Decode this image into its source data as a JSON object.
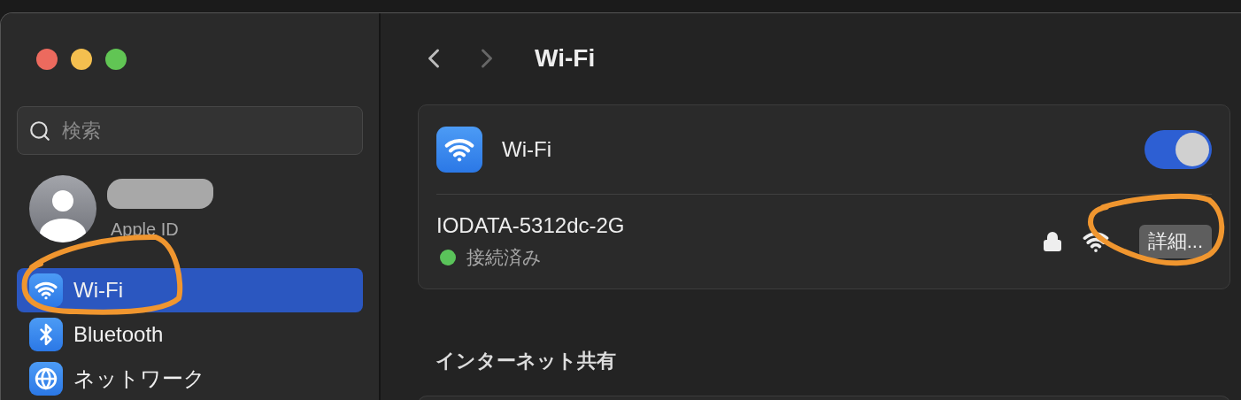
{
  "window": {
    "controls": [
      {
        "color": "#ec6a5e"
      },
      {
        "color": "#f4bf4f"
      },
      {
        "color": "#61c554"
      }
    ]
  },
  "sidebar": {
    "search": {
      "placeholder": "検索"
    },
    "account": {
      "label": "Apple ID"
    },
    "items": [
      {
        "label": "Wi-Fi",
        "kind": "wifi",
        "selected": true
      },
      {
        "label": "Bluetooth",
        "kind": "bluetooth",
        "selected": false
      },
      {
        "label": "ネットワーク",
        "kind": "globe",
        "selected": false
      }
    ]
  },
  "header": {
    "title": "Wi-Fi"
  },
  "wifi_card": {
    "label": "Wi-Fi",
    "on": true,
    "network": {
      "name": "IODATA-5312dc-2G",
      "status": "接続済み",
      "connected": true,
      "button": "詳細..."
    }
  },
  "section": {
    "title": "インターネット共有"
  }
}
